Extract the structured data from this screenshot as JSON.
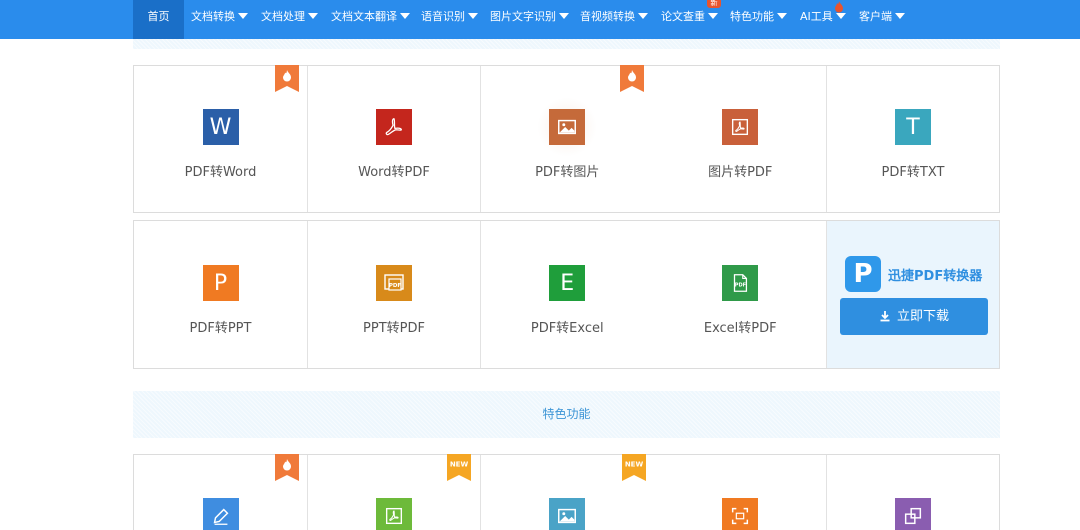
{
  "nav": {
    "items": [
      {
        "label": "首页",
        "caret": false
      },
      {
        "label": "文档转换",
        "caret": true
      },
      {
        "label": "文档处理",
        "caret": true
      },
      {
        "label": "文档文本翻译",
        "caret": true
      },
      {
        "label": "语音识别",
        "caret": true
      },
      {
        "label": "图片文字识别",
        "caret": true
      },
      {
        "label": "音视频转换",
        "caret": true
      },
      {
        "label": "论文查重",
        "caret": true
      },
      {
        "label": "特色功能",
        "caret": true
      },
      {
        "label": "AI工具",
        "caret": true
      },
      {
        "label": "客户端",
        "caret": true
      }
    ],
    "paper_badge": "新",
    "accent": "#2a8cec"
  },
  "tools_row1": [
    {
      "label": "PDF转Word",
      "icon": "word-icon",
      "glyph": "W",
      "color": "#2b5fa8",
      "hot": true
    },
    {
      "label": "Word转PDF",
      "icon": "pdf-acrobat-icon",
      "glyph": "",
      "color": "#c4261d",
      "hot": false
    },
    {
      "label": "PDF转图片",
      "icon": "image-icon",
      "glyph": "",
      "color": "#c56a3a",
      "hot": true
    },
    {
      "label": "图片转PDF",
      "icon": "pdf-doc-icon",
      "glyph": "",
      "color": "#c9603a",
      "hot": false
    },
    {
      "label": "PDF转TXT",
      "icon": "txt-icon",
      "glyph": "T",
      "color": "#3aa7be",
      "hot": false
    }
  ],
  "tools_row2": [
    {
      "label": "PDF转PPT",
      "icon": "ppt-icon",
      "glyph": "P",
      "color": "#f07a22"
    },
    {
      "label": "PPT转PDF",
      "icon": "ppt-pdf-icon",
      "glyph": "PDF",
      "color": "#d88a1a"
    },
    {
      "label": "PDF转Excel",
      "icon": "excel-icon",
      "glyph": "E",
      "color": "#1f9e3b"
    },
    {
      "label": "Excel转PDF",
      "icon": "excel-pdf-icon",
      "glyph": "PDF",
      "color": "#2f9a49"
    }
  ],
  "promo": {
    "logo_letter": "P",
    "name": "迅捷PDF转换器",
    "button": "立即下载",
    "color": "#2f8fe0"
  },
  "section_title": "特色功能",
  "ribbons": {
    "hot": "hot",
    "new": "NEW"
  },
  "tools_row3": [
    {
      "icon": "edit-icon",
      "color": "#3f8de0",
      "ribbon": "hot"
    },
    {
      "icon": "pdf-green-icon",
      "color": "#6dba3a",
      "ribbon": "new"
    },
    {
      "icon": "picture-icon",
      "color": "#4aa3c7",
      "ribbon": "new"
    },
    {
      "icon": "scan-icon",
      "color": "#f07a22",
      "ribbon": "none"
    },
    {
      "icon": "split-icon",
      "color": "#8a5db0",
      "ribbon": "none"
    }
  ]
}
